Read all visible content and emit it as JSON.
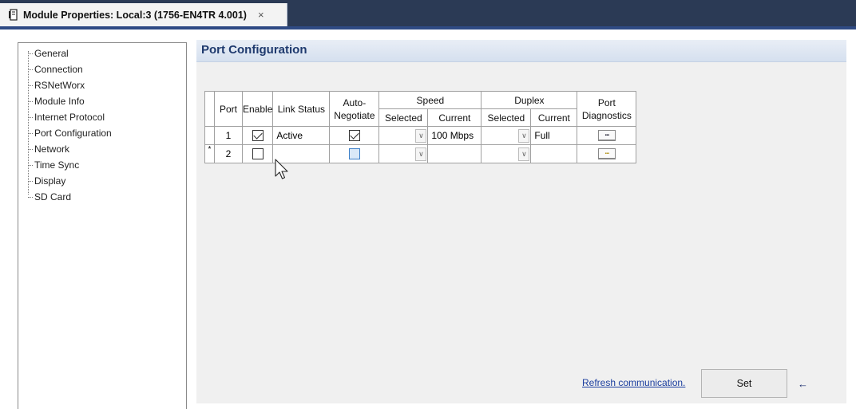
{
  "tab": {
    "title": "Module Properties: Local:3 (1756-EN4TR 4.001)",
    "close": "×",
    "icon": "module-file-icon"
  },
  "tree": {
    "items": [
      {
        "label": "General"
      },
      {
        "label": "Connection"
      },
      {
        "label": "RSNetWorx"
      },
      {
        "label": "Module Info"
      },
      {
        "label": "Internet Protocol"
      },
      {
        "label": "Port Configuration",
        "selected": true
      },
      {
        "label": "Network"
      },
      {
        "label": "Time Sync"
      },
      {
        "label": "Display"
      },
      {
        "label": "SD Card"
      }
    ]
  },
  "section": {
    "title": "Port Configuration"
  },
  "grid": {
    "headers": {
      "port": "Port",
      "enable": "Enable",
      "link_status": "Link Status",
      "auto_negotiate": "Auto-\nNegotiate",
      "speed": "Speed",
      "duplex": "Duplex",
      "selected": "Selected",
      "current": "Current",
      "port_diag": "Port\nDiagnostics"
    },
    "rows": [
      {
        "marker": "",
        "port": "1",
        "enable": true,
        "link_status": "Active",
        "auto_negotiate": true,
        "speed_selected": "",
        "speed_current": "100 Mbps",
        "duplex_selected": "",
        "duplex_current": "Full",
        "diag_button": "..."
      },
      {
        "marker": "*",
        "port": "2",
        "enable": false,
        "link_status": "",
        "auto_negotiate": false,
        "speed_selected": "",
        "speed_current": "",
        "duplex_selected": "",
        "duplex_current": "",
        "diag_button": "..."
      }
    ],
    "dropdown_glyph": "∨"
  },
  "footer": {
    "refresh_link": "Refresh communication.",
    "set_button": "Set",
    "arrow": "←"
  },
  "colors": {
    "tab_strip": "#2b3a55",
    "accent": "#2f4a84",
    "link": "#1a3d9e",
    "section_title": "#1f3a6e"
  }
}
